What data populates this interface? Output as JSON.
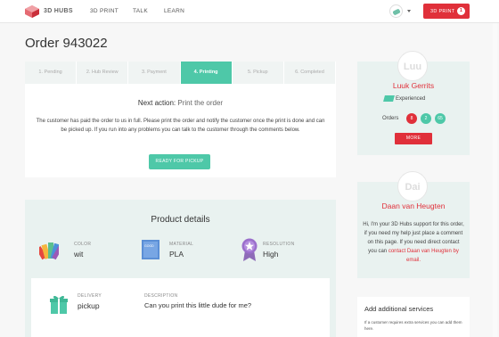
{
  "header": {
    "logo_text": "3D HUBS",
    "nav": [
      "3D PRINT",
      "TALK",
      "LEARN"
    ],
    "print_button": "3D PRINT",
    "print_count": "1"
  },
  "order": {
    "title": "Order 943022"
  },
  "steps": [
    "1. Pending",
    "2. Hub Review",
    "3. Payment",
    "4. Printing",
    "5. Pickup",
    "6. Completed"
  ],
  "next_action": {
    "label": "Next action:",
    "value": "Print the order",
    "description": "The customer has paid the order to us in full. Please print the order and notify the customer once the print is done and can be picked up. If you run into any problems you can talk to the customer through the comments below.",
    "button": "READY FOR PICKUP"
  },
  "product": {
    "title": "Product details",
    "color_label": "COLOR",
    "color_value": "wit",
    "material_label": "MATERIAL",
    "material_value": "PLA",
    "resolution_label": "RESOLUTION",
    "resolution_value": "High",
    "delivery_label": "DELIVERY",
    "delivery_value": "pickup",
    "description_label": "DESCRIPTION",
    "description_value": "Can you print this little dude for me?"
  },
  "customer": {
    "avatar_text": "Luu",
    "name": "Luuk Gerrits",
    "level": "Experienced",
    "orders_label": "Orders",
    "counts": [
      "8",
      "2",
      "65"
    ],
    "more_button": "MORE"
  },
  "support": {
    "avatar_text": "Dai",
    "name": "Daan van Heugten",
    "text": "Hi, I'm your 3D Hubs support for this order, if you need my help just place a comment on this page. If you need direct contact you can",
    "link": "contact Daan van Heugten by email."
  },
  "services": {
    "title": "Add additional services",
    "text": "If a customer requires extra services you can add them here."
  },
  "colors": {
    "brand_red": "#e0303a",
    "accent_teal": "#4ec8a8"
  }
}
